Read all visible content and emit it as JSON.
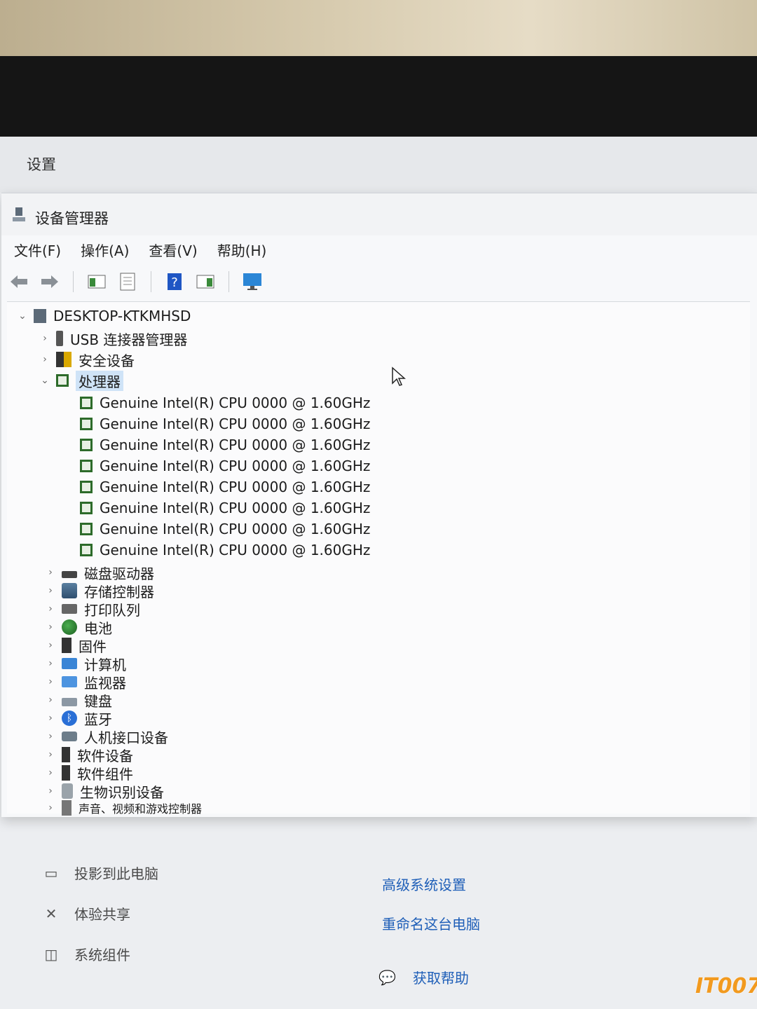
{
  "settings_window": {
    "title": "设置",
    "left_items": [
      "投影到此电脑",
      "体验共享",
      "系统组件"
    ],
    "right_links": [
      "高级系统设置",
      "重命名这台电脑"
    ],
    "help_link": "获取帮助"
  },
  "device_manager": {
    "title": "设备管理器",
    "menu": [
      "文件(F)",
      "操作(A)",
      "查看(V)",
      "帮助(H)"
    ],
    "toolbar_icons": [
      "back-arrow-icon",
      "forward-arrow-icon",
      "show-hide-console-tree-icon",
      "properties-icon",
      "help-icon",
      "action-pane-icon",
      "monitor-icon"
    ],
    "tree": {
      "root": "DESKTOP-KTKMHSD",
      "categories_before": [
        "USB 连接器管理器",
        "安全设备"
      ],
      "expanded_category": "处理器",
      "processors": [
        "Genuine Intel(R) CPU 0000 @ 1.60GHz",
        "Genuine Intel(R) CPU 0000 @ 1.60GHz",
        "Genuine Intel(R) CPU 0000 @ 1.60GHz",
        "Genuine Intel(R) CPU 0000 @ 1.60GHz",
        "Genuine Intel(R) CPU 0000 @ 1.60GHz",
        "Genuine Intel(R) CPU 0000 @ 1.60GHz",
        "Genuine Intel(R) CPU 0000 @ 1.60GHz",
        "Genuine Intel(R) CPU 0000 @ 1.60GHz"
      ],
      "categories_after": [
        "磁盘驱动器",
        "存储控制器",
        "打印队列",
        "电池",
        "固件",
        "计算机",
        "监视器",
        "键盘",
        "蓝牙",
        "人机接口设备",
        "软件设备",
        "软件组件",
        "生物识别设备",
        "声音、视频和游戏控制器"
      ]
    }
  },
  "watermark": "IT007"
}
